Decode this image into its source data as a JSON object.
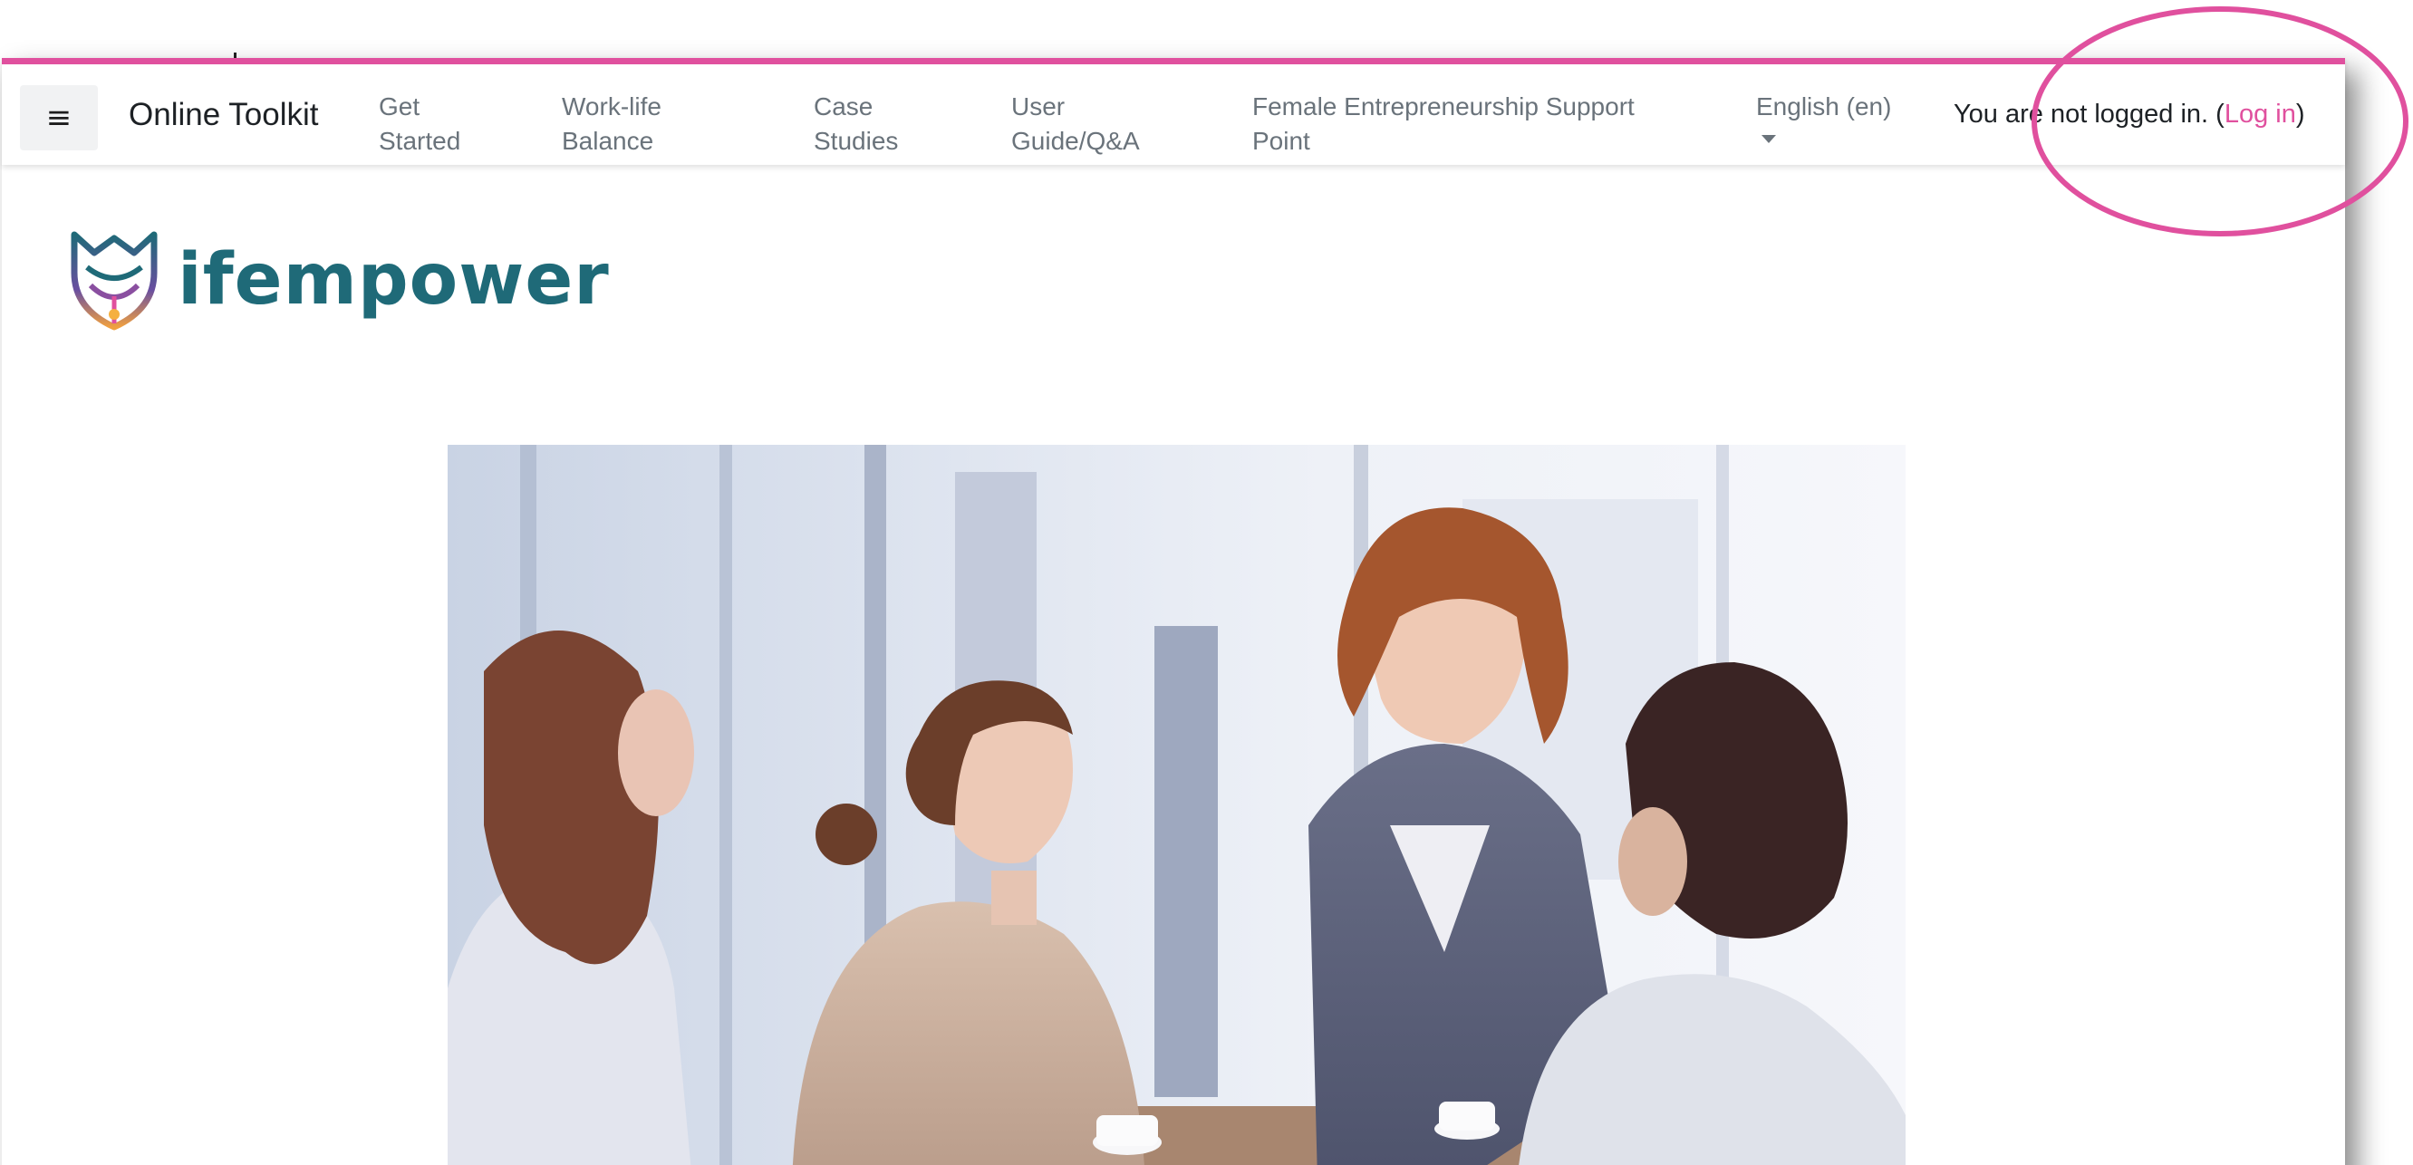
{
  "navbar": {
    "menu_icon": "hamburger-menu-icon",
    "brand": "Online Toolkit",
    "items": [
      {
        "label": "Get Started"
      },
      {
        "label": "Work-life Balance"
      },
      {
        "label": "Case Studies"
      },
      {
        "label": "User Guide/Q&A"
      },
      {
        "label": "Female Entrepreneurship Support Point"
      }
    ],
    "language": "English (en)",
    "login_prefix": "You are not logged in. (",
    "login_link": "Log in",
    "login_suffix": ")"
  },
  "logo": {
    "text": "ifempower",
    "icon": "fox-flower-logo-icon"
  },
  "hero": {
    "icon": "business-meeting-photo"
  },
  "colors": {
    "accent": "#e0509e",
    "logo_teal": "#1f6a78",
    "nav_text": "#6a737b",
    "text": "#1d2125"
  }
}
